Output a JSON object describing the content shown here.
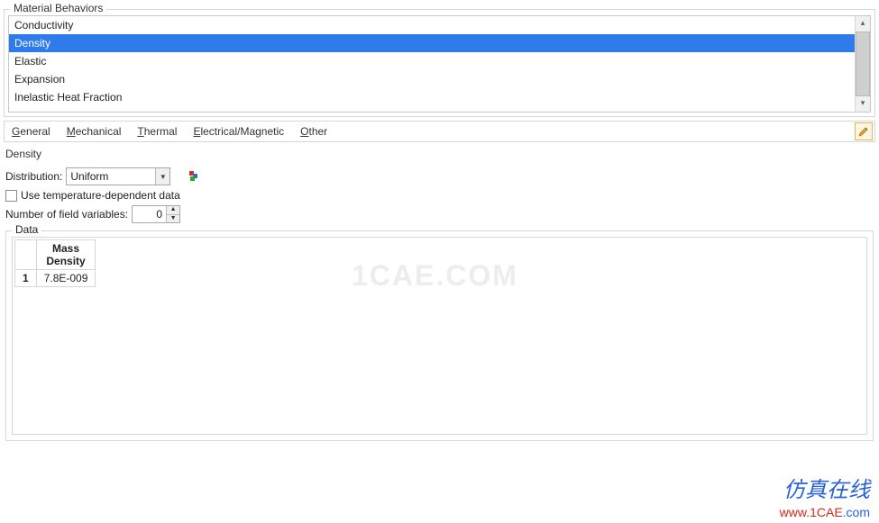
{
  "groupTitle": "Material Behaviors",
  "behaviors": [
    "Conductivity",
    "Density",
    "Elastic",
    "Expansion",
    "Inelastic Heat Fraction"
  ],
  "behaviorsSelectedIndex": 1,
  "menus": {
    "general": "General",
    "mechanical": "Mechanical",
    "thermal": "Thermal",
    "electrical": "Electrical/Magnetic",
    "other": "Other"
  },
  "sectionTitle": "Density",
  "distribution": {
    "label": "Distribution:",
    "value": "Uniform"
  },
  "tempDependent": {
    "label": "Use temperature-dependent data",
    "checked": false
  },
  "fieldVars": {
    "label": "Number of field variables:",
    "value": "0"
  },
  "dataGroupTitle": "Data",
  "table": {
    "header": "Mass\nDensity",
    "headerLine1": "Mass",
    "headerLine2": "Density",
    "rows": [
      {
        "num": "1",
        "value": "7.8E-009"
      }
    ]
  },
  "watermark": "1CAE.COM",
  "wm_cn": "仿真在线",
  "wm_url_prefix": "www.",
  "wm_url_main": "1CAE",
  "wm_url_suffix": ".com"
}
